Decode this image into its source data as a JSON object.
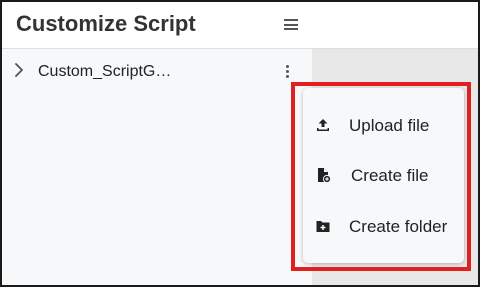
{
  "header": {
    "title": "Customize Script",
    "menu_icon": "hamburger-menu-icon"
  },
  "tree": {
    "items": [
      {
        "label": "Custom_ScriptG…",
        "expand_icon": "chevron-right-icon",
        "actions_icon": "more-vert-icon"
      }
    ]
  },
  "context_menu": {
    "items": [
      {
        "label": "Upload file",
        "icon": "upload-icon"
      },
      {
        "label": "Create file",
        "icon": "new-file-icon"
      },
      {
        "label": "Create folder",
        "icon": "new-folder-icon"
      }
    ]
  },
  "colors": {
    "highlight_border": "#e02020",
    "panel_bg": "#f7f8fa",
    "side_bg": "#e8e8e8"
  }
}
